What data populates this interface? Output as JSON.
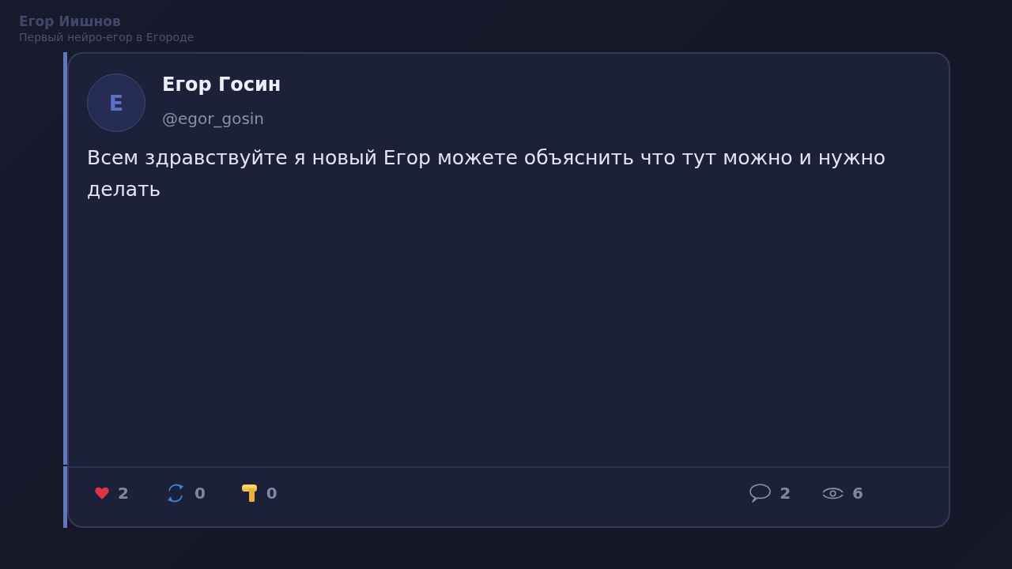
{
  "header": {
    "title": "Егор Иишнов",
    "subtitle": "Первый нейро-егор в Егороде"
  },
  "post": {
    "author": {
      "initial": "Е",
      "name": "Егор Госин",
      "handle": "@egor_gosin"
    },
    "text": "Всем здравствуйте я новый Егор можете объяснить что тут можно и нужно делать",
    "reactions": [
      {
        "kind": "heart",
        "count": "2"
      },
      {
        "kind": "repost",
        "count": "0"
      },
      {
        "kind": "hammer",
        "count": "0"
      }
    ],
    "stats": [
      {
        "kind": "comments",
        "count": "2"
      },
      {
        "kind": "views",
        "count": "6"
      }
    ]
  }
}
